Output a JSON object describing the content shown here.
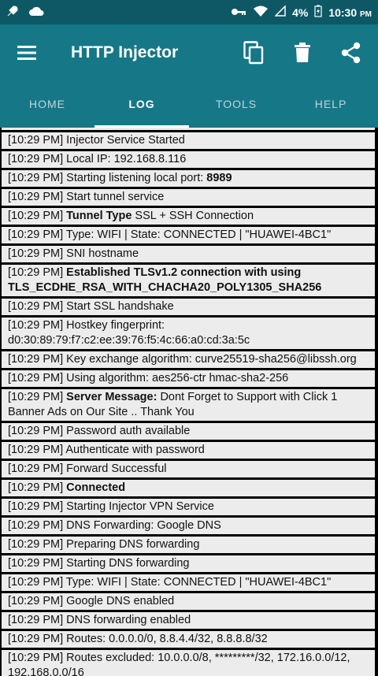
{
  "status_bar": {
    "battery": "4%",
    "time": "10:30",
    "ampm": "PM"
  },
  "app": {
    "title": "HTTP Injector"
  },
  "tabs": [
    {
      "label": "HOME"
    },
    {
      "label": "LOG"
    },
    {
      "label": "TOOLS"
    },
    {
      "label": "HELP"
    }
  ],
  "log": [
    {
      "time": "[10:29 PM]",
      "pre": "Injector Service Started",
      "bold": "",
      "post": ""
    },
    {
      "time": "[10:29 PM]",
      "pre": "Local IP: 192.168.8.116",
      "bold": "",
      "post": ""
    },
    {
      "time": "[10:29 PM]",
      "pre": "Starting listening local port: ",
      "bold": "8989",
      "post": ""
    },
    {
      "time": "[10:29 PM]",
      "pre": "Start tunnel service",
      "bold": "",
      "post": ""
    },
    {
      "time": "[10:29 PM]",
      "pre": "",
      "bold": "Tunnel Type",
      "post": " SSL + SSH Connection"
    },
    {
      "time": "[10:29 PM]",
      "pre": "Type: WIFI | State: CONNECTED | \"HUAWEI-4BC1\"",
      "bold": "",
      "post": ""
    },
    {
      "time": "[10:29 PM]",
      "pre": "SNI hostname",
      "bold": "",
      "post": ""
    },
    {
      "time": "[10:29 PM]",
      "pre": "",
      "bold": "Established TLSv1.2 connection with using TLS_ECDHE_RSA_WITH_CHACHA20_POLY1305_SHA256",
      "post": ""
    },
    {
      "time": "[10:29 PM]",
      "pre": "Start SSL handshake",
      "bold": "",
      "post": ""
    },
    {
      "time": "[10:29 PM]",
      "pre": "Hostkey fingerprint: d0:30:89:79:f7:c2:ee:39:76:f5:4c:66:a0:cd:3a:5c",
      "bold": "",
      "post": ""
    },
    {
      "time": "[10:29 PM]",
      "pre": "Key exchange algorithm: curve25519-sha256@libssh.org",
      "bold": "",
      "post": ""
    },
    {
      "time": "[10:29 PM]",
      "pre": "Using algorithm: aes256-ctr hmac-sha2-256",
      "bold": "",
      "post": ""
    },
    {
      "time": "[10:29 PM]",
      "pre": "",
      "bold": "Server Message:",
      "post": " Dont Forget to Support with Click 1 Banner Ads on Our Site .. Thank You"
    },
    {
      "time": "[10:29 PM]",
      "pre": "Password auth available",
      "bold": "",
      "post": ""
    },
    {
      "time": "[10:29 PM]",
      "pre": "Authenticate with password",
      "bold": "",
      "post": ""
    },
    {
      "time": "[10:29 PM]",
      "pre": "Forward Successful",
      "bold": "",
      "post": ""
    },
    {
      "time": "[10:29 PM]",
      "pre": "",
      "bold": "Connected",
      "post": ""
    },
    {
      "time": "[10:29 PM]",
      "pre": "Starting Injector VPN Service",
      "bold": "",
      "post": ""
    },
    {
      "time": "[10:29 PM]",
      "pre": "DNS Forwarding: Google DNS",
      "bold": "",
      "post": ""
    },
    {
      "time": "[10:29 PM]",
      "pre": "Preparing DNS forwarding",
      "bold": "",
      "post": ""
    },
    {
      "time": "[10:29 PM]",
      "pre": "Starting DNS forwarding",
      "bold": "",
      "post": ""
    },
    {
      "time": "[10:29 PM]",
      "pre": "Type: WIFI | State: CONNECTED | \"HUAWEI-4BC1\"",
      "bold": "",
      "post": ""
    },
    {
      "time": "[10:29 PM]",
      "pre": "Google DNS enabled",
      "bold": "",
      "post": ""
    },
    {
      "time": "[10:29 PM]",
      "pre": "DNS forwarding enabled",
      "bold": "",
      "post": ""
    },
    {
      "time": "[10:29 PM]",
      "pre": "Routes: 0.0.0.0/0, 8.8.4.4/32, 8.8.8.8/32",
      "bold": "",
      "post": ""
    },
    {
      "time": "[10:29 PM]",
      "pre": "Routes excluded: 10.0.0.0/8, *********/32, 172.16.0.0/12, 192.168.0.0/16",
      "bold": "",
      "post": ""
    }
  ]
}
